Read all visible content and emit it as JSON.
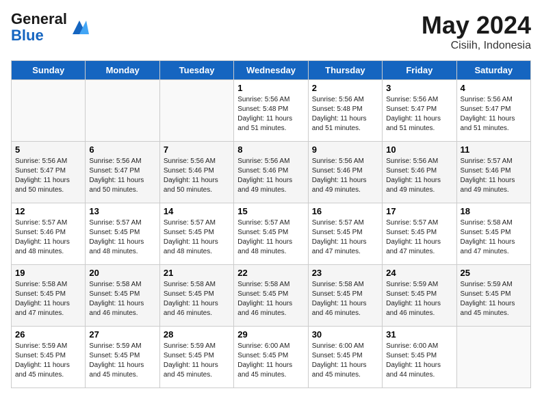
{
  "header": {
    "logo_line1": "General",
    "logo_line2": "Blue",
    "title": "May 2024",
    "location": "Cisiih, Indonesia"
  },
  "days_of_week": [
    "Sunday",
    "Monday",
    "Tuesday",
    "Wednesday",
    "Thursday",
    "Friday",
    "Saturday"
  ],
  "weeks": [
    [
      {
        "day": "",
        "info": ""
      },
      {
        "day": "",
        "info": ""
      },
      {
        "day": "",
        "info": ""
      },
      {
        "day": "1",
        "info": "Sunrise: 5:56 AM\nSunset: 5:48 PM\nDaylight: 11 hours\nand 51 minutes."
      },
      {
        "day": "2",
        "info": "Sunrise: 5:56 AM\nSunset: 5:48 PM\nDaylight: 11 hours\nand 51 minutes."
      },
      {
        "day": "3",
        "info": "Sunrise: 5:56 AM\nSunset: 5:47 PM\nDaylight: 11 hours\nand 51 minutes."
      },
      {
        "day": "4",
        "info": "Sunrise: 5:56 AM\nSunset: 5:47 PM\nDaylight: 11 hours\nand 51 minutes."
      }
    ],
    [
      {
        "day": "5",
        "info": "Sunrise: 5:56 AM\nSunset: 5:47 PM\nDaylight: 11 hours\nand 50 minutes."
      },
      {
        "day": "6",
        "info": "Sunrise: 5:56 AM\nSunset: 5:47 PM\nDaylight: 11 hours\nand 50 minutes."
      },
      {
        "day": "7",
        "info": "Sunrise: 5:56 AM\nSunset: 5:46 PM\nDaylight: 11 hours\nand 50 minutes."
      },
      {
        "day": "8",
        "info": "Sunrise: 5:56 AM\nSunset: 5:46 PM\nDaylight: 11 hours\nand 49 minutes."
      },
      {
        "day": "9",
        "info": "Sunrise: 5:56 AM\nSunset: 5:46 PM\nDaylight: 11 hours\nand 49 minutes."
      },
      {
        "day": "10",
        "info": "Sunrise: 5:56 AM\nSunset: 5:46 PM\nDaylight: 11 hours\nand 49 minutes."
      },
      {
        "day": "11",
        "info": "Sunrise: 5:57 AM\nSunset: 5:46 PM\nDaylight: 11 hours\nand 49 minutes."
      }
    ],
    [
      {
        "day": "12",
        "info": "Sunrise: 5:57 AM\nSunset: 5:46 PM\nDaylight: 11 hours\nand 48 minutes."
      },
      {
        "day": "13",
        "info": "Sunrise: 5:57 AM\nSunset: 5:45 PM\nDaylight: 11 hours\nand 48 minutes."
      },
      {
        "day": "14",
        "info": "Sunrise: 5:57 AM\nSunset: 5:45 PM\nDaylight: 11 hours\nand 48 minutes."
      },
      {
        "day": "15",
        "info": "Sunrise: 5:57 AM\nSunset: 5:45 PM\nDaylight: 11 hours\nand 48 minutes."
      },
      {
        "day": "16",
        "info": "Sunrise: 5:57 AM\nSunset: 5:45 PM\nDaylight: 11 hours\nand 47 minutes."
      },
      {
        "day": "17",
        "info": "Sunrise: 5:57 AM\nSunset: 5:45 PM\nDaylight: 11 hours\nand 47 minutes."
      },
      {
        "day": "18",
        "info": "Sunrise: 5:58 AM\nSunset: 5:45 PM\nDaylight: 11 hours\nand 47 minutes."
      }
    ],
    [
      {
        "day": "19",
        "info": "Sunrise: 5:58 AM\nSunset: 5:45 PM\nDaylight: 11 hours\nand 47 minutes."
      },
      {
        "day": "20",
        "info": "Sunrise: 5:58 AM\nSunset: 5:45 PM\nDaylight: 11 hours\nand 46 minutes."
      },
      {
        "day": "21",
        "info": "Sunrise: 5:58 AM\nSunset: 5:45 PM\nDaylight: 11 hours\nand 46 minutes."
      },
      {
        "day": "22",
        "info": "Sunrise: 5:58 AM\nSunset: 5:45 PM\nDaylight: 11 hours\nand 46 minutes."
      },
      {
        "day": "23",
        "info": "Sunrise: 5:58 AM\nSunset: 5:45 PM\nDaylight: 11 hours\nand 46 minutes."
      },
      {
        "day": "24",
        "info": "Sunrise: 5:59 AM\nSunset: 5:45 PM\nDaylight: 11 hours\nand 46 minutes."
      },
      {
        "day": "25",
        "info": "Sunrise: 5:59 AM\nSunset: 5:45 PM\nDaylight: 11 hours\nand 45 minutes."
      }
    ],
    [
      {
        "day": "26",
        "info": "Sunrise: 5:59 AM\nSunset: 5:45 PM\nDaylight: 11 hours\nand 45 minutes."
      },
      {
        "day": "27",
        "info": "Sunrise: 5:59 AM\nSunset: 5:45 PM\nDaylight: 11 hours\nand 45 minutes."
      },
      {
        "day": "28",
        "info": "Sunrise: 5:59 AM\nSunset: 5:45 PM\nDaylight: 11 hours\nand 45 minutes."
      },
      {
        "day": "29",
        "info": "Sunrise: 6:00 AM\nSunset: 5:45 PM\nDaylight: 11 hours\nand 45 minutes."
      },
      {
        "day": "30",
        "info": "Sunrise: 6:00 AM\nSunset: 5:45 PM\nDaylight: 11 hours\nand 45 minutes."
      },
      {
        "day": "31",
        "info": "Sunrise: 6:00 AM\nSunset: 5:45 PM\nDaylight: 11 hours\nand 44 minutes."
      },
      {
        "day": "",
        "info": ""
      }
    ]
  ]
}
